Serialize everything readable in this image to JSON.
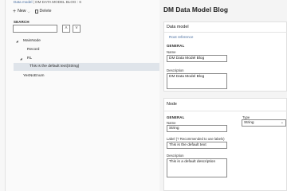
{
  "breadcrumb": {
    "root": "Data model",
    "separator": "|",
    "current": "DM DATA MODEL BLOG : 6"
  },
  "toolbar": {
    "new_label": "New",
    "delete_label": "Delete"
  },
  "search": {
    "label": "SEARCH",
    "value": "",
    "up_icon": "chevron-up-icon",
    "down_icon": "chevron-down-icon"
  },
  "tree": {
    "items": [
      {
        "label": "MainNode",
        "expanded": true
      },
      {
        "label": "Record"
      },
      {
        "label": "RL",
        "expanded": true
      },
      {
        "label": "This is the default text(String)",
        "selected": true
      },
      {
        "label": "YesNoEnum"
      }
    ]
  },
  "page": {
    "title": "DM Data Model Blog"
  },
  "data_model": {
    "title": "Data model",
    "root_reference": "Root reference",
    "group": "GENERAL",
    "name_label": "Name",
    "name_value": "DM Data Model Blog",
    "description_label": "Description",
    "description_value": "DM Data Model Blog"
  },
  "node": {
    "title": "Node",
    "group": "GENERAL",
    "name_label": "Name",
    "name_value": "String",
    "type_label": "Type",
    "type_value": "String",
    "label_label": "Label (? Recommended to use labels)",
    "label_value": "This is the default text",
    "description_label": "Description",
    "description_value": "This is a default description"
  },
  "colors": {
    "link": "#4a6fa0",
    "selected_row": "#dfe4ea",
    "background": "#f4f4f4"
  }
}
